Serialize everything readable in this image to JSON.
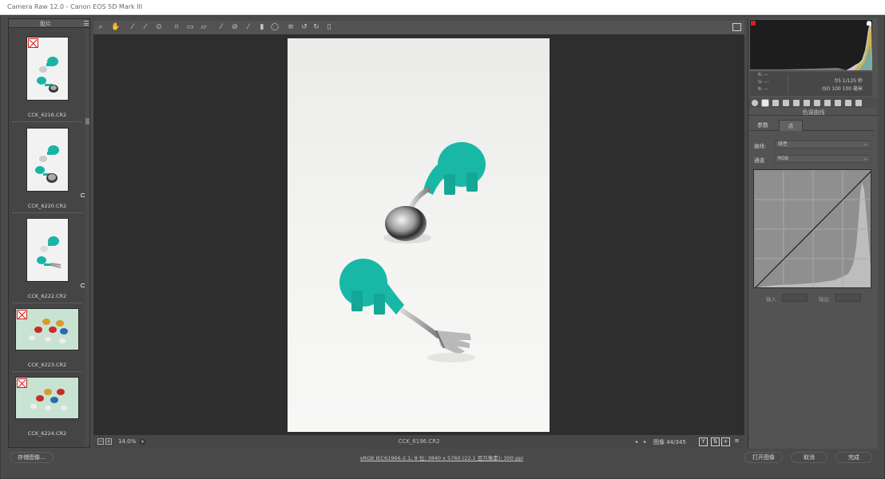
{
  "window": {
    "title": "Camera Raw 12.0  -  Canon EOS 5D Mark III"
  },
  "filmstrip": {
    "label": "胶片",
    "items": [
      {
        "name": "CCK_6216.CR2",
        "rejected": true
      },
      {
        "name": "CCK_6220.CR2",
        "rejected": false
      },
      {
        "name": "CCK_6222.CR2",
        "rejected": false
      },
      {
        "name": "CCK_6223.CR2",
        "rejected": true
      },
      {
        "name": "CCK_6224.CR2",
        "rejected": true
      }
    ]
  },
  "toolbar": {
    "tools": [
      "zoom-tool",
      "hand-tool",
      "white-balance-tool",
      "color-sampler-tool",
      "targeted-adjustment-tool",
      "crop-tool",
      "straighten-tool",
      "transform-tool",
      "spot-removal-tool",
      "red-eye-tool",
      "adjustment-brush-tool",
      "graduated-filter-tool",
      "radial-filter-tool",
      "preferences",
      "rotate-left",
      "rotate-right",
      "trash"
    ]
  },
  "statusbar": {
    "zoom": "14.0%",
    "filename": "CCK_6196.CR2",
    "counter": "图像 44/345"
  },
  "histogram": {
    "exif_line1": "f/5   1/125 秒",
    "exif_line2": "ISO 100   100 毫米",
    "r_label": "R:",
    "g_label": "G:",
    "b_label": "B:",
    "rgb_value": "---"
  },
  "panel": {
    "section_title": "色调曲线",
    "tab_parametric": "参数",
    "tab_point": "点",
    "curve_label": "曲线:",
    "curve_value": "线性",
    "channel_label": "通道",
    "channel_value": "RGB",
    "input_label": "输入",
    "output_label": "输出"
  },
  "footer": {
    "save": "存储图像...",
    "workflow": "sRGB IEC61966-2.1; 8 位; 3840 x 5760 (22.1 百万像素); 300 ppi",
    "open": "打开图像",
    "cancel": "取消",
    "done": "完成"
  },
  "colors": {
    "accent_teal": "#18b5a4",
    "canvas": "#2e2e2e",
    "panel": "#535353"
  }
}
